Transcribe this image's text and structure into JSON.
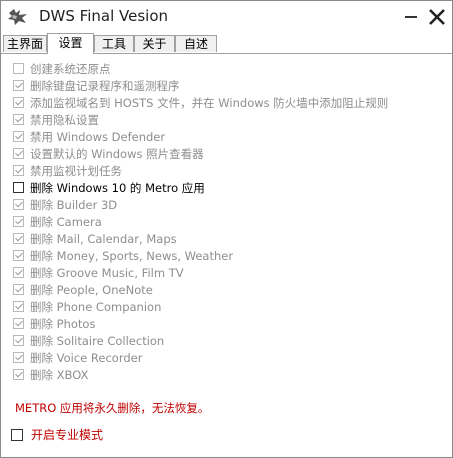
{
  "window": {
    "title": "DWS Final Vesion"
  },
  "tabs": [
    {
      "label": "主界面",
      "active": false
    },
    {
      "label": "设置",
      "active": true
    },
    {
      "label": "工具",
      "active": false
    },
    {
      "label": "关于",
      "active": false
    },
    {
      "label": "自述",
      "active": false
    }
  ],
  "options": [
    {
      "label": "创建系统还原点",
      "checked": false,
      "enabled": false
    },
    {
      "label": "删除键盘记录程序和遥测程序",
      "checked": true,
      "enabled": false
    },
    {
      "label": "添加监视域名到 HOSTS 文件，并在 Windows 防火墙中添加阻止规则",
      "checked": true,
      "enabled": false
    },
    {
      "label": "禁用隐私设置",
      "checked": true,
      "enabled": false
    },
    {
      "label": "禁用 Windows Defender",
      "checked": true,
      "enabled": false
    },
    {
      "label": "设置默认的 Windows 照片查看器",
      "checked": true,
      "enabled": false
    },
    {
      "label": "禁用监视计划任务",
      "checked": true,
      "enabled": false
    },
    {
      "label": "删除 Windows 10 的 Metro 应用",
      "checked": false,
      "enabled": true
    },
    {
      "label": "删除 Builder 3D",
      "checked": true,
      "enabled": false
    },
    {
      "label": "删除 Camera",
      "checked": true,
      "enabled": false
    },
    {
      "label": "删除 Mail, Calendar, Maps",
      "checked": true,
      "enabled": false
    },
    {
      "label": "删除 Money, Sports, News, Weather",
      "checked": true,
      "enabled": false
    },
    {
      "label": "删除 Groove Music, Film TV",
      "checked": true,
      "enabled": false
    },
    {
      "label": "删除 People, OneNote",
      "checked": true,
      "enabled": false
    },
    {
      "label": "删除 Phone Companion",
      "checked": true,
      "enabled": false
    },
    {
      "label": "删除 Photos",
      "checked": true,
      "enabled": false
    },
    {
      "label": "删除 Solitaire Collection",
      "checked": true,
      "enabled": false
    },
    {
      "label": "删除 Voice Recorder",
      "checked": true,
      "enabled": false
    },
    {
      "label": "删除 XBOX",
      "checked": true,
      "enabled": false
    }
  ],
  "warning": "METRO 应用将永久删除，无法恢复。",
  "expert_mode": {
    "label": "开启专业模式",
    "checked": false
  },
  "colors": {
    "warning": "#c00000",
    "disabled_text": "#8e8e8e"
  }
}
